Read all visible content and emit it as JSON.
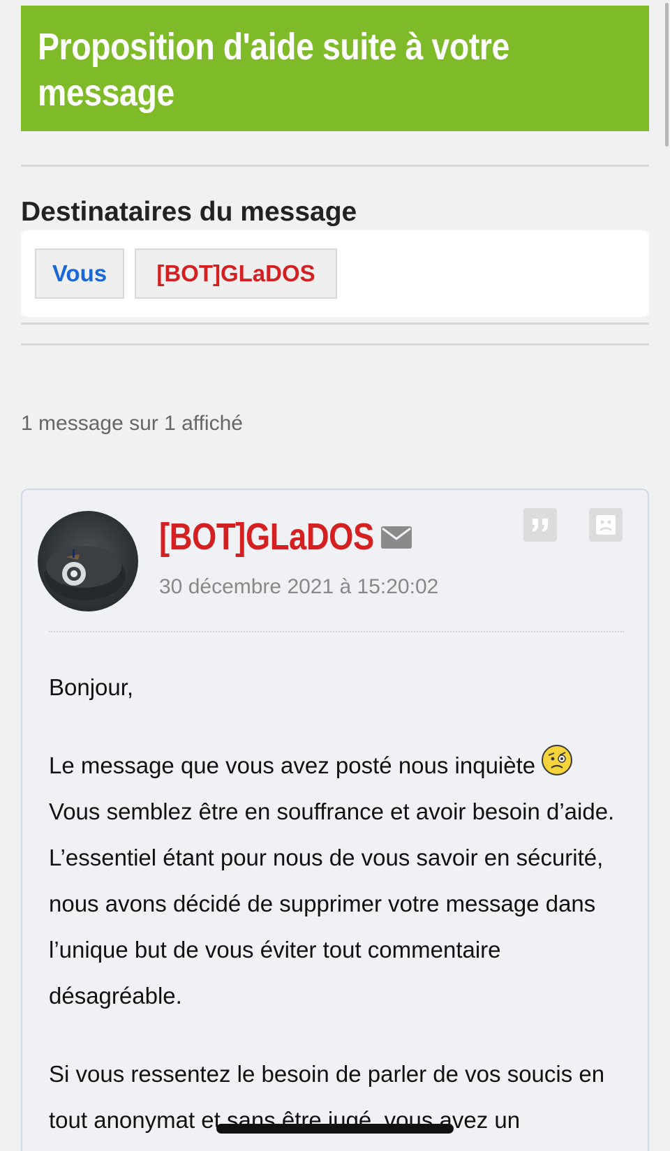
{
  "page": {
    "title": "Proposition d'aide suite à votre message"
  },
  "recipients": {
    "heading": "Destinataires du message",
    "items": [
      {
        "label": "Vous",
        "color": "#1a67d6"
      },
      {
        "label": "[BOT]GLaDOS",
        "color": "#d42020"
      }
    ]
  },
  "thread": {
    "count_text": "1 message sur 1 affiché"
  },
  "post": {
    "author": "[BOT]GLaDOS",
    "date": "30 décembre 2021 à 15:20:02",
    "icons": [
      "mail-icon",
      "quote-icon",
      "sad-face-icon",
      "worried-emoji-icon"
    ],
    "greeting": "Bonjour,",
    "paragraph1_line1": "Le message que vous avez posté nous inquiète",
    "paragraph1_rest": "Vous semblez être en souffrance et avoir besoin d’aide. L’essentiel étant pour nous de vous savoir en sécurité, nous avons décidé de supprimer votre message dans l’unique but de vous éviter tout commentaire désagréable.",
    "paragraph2": "Si vous ressentez le besoin de parler de vos soucis en tout anonymat et sans être jugé, vous avez un"
  },
  "colors": {
    "banner": "#7fba29",
    "bot_red": "#d42020",
    "user_blue": "#1a67d6"
  }
}
